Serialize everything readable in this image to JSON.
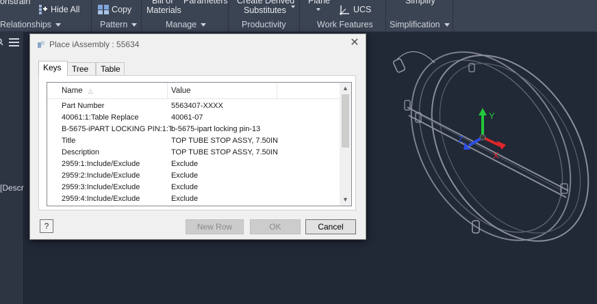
{
  "ribbon": {
    "top_items": [
      {
        "label": "onstrain",
        "icon": "constrain-icon"
      },
      {
        "label": "Hide All",
        "icon": "hide-all-icon"
      },
      {
        "label": "Copy",
        "icon": "copy-icon"
      },
      {
        "label": "Bill of",
        "icon": ""
      },
      {
        "label": "Materials",
        "icon": ""
      },
      {
        "label": "Parameters",
        "icon": ""
      },
      {
        "label": "Create Derived",
        "icon": ""
      },
      {
        "label": "Substitutes",
        "icon": ""
      },
      {
        "label": "Plane",
        "icon": "plane-icon"
      },
      {
        "label": "UCS",
        "icon": "ucs-icon"
      },
      {
        "label": "Simplify",
        "icon": ""
      }
    ],
    "panels": [
      {
        "label": "Relationships"
      },
      {
        "label": "Pattern"
      },
      {
        "label": "Manage"
      },
      {
        "label": "Productivity"
      },
      {
        "label": "Work Features"
      },
      {
        "label": "Simplification"
      }
    ]
  },
  "left": {
    "partial_text": "[Descri"
  },
  "dialog": {
    "title": "Place iAssembly : 55634",
    "tabs": [
      "Keys",
      "Tree",
      "Table"
    ],
    "columns": [
      "Name",
      "Value"
    ],
    "rows": [
      {
        "name": "Part Number",
        "value": "5563407-XXXX"
      },
      {
        "name": "40061:1:Table Replace",
        "value": "40061-07"
      },
      {
        "name": "B-5675-iPART LOCKING PIN:1:Ta",
        "value": "b-5675-ipart locking pin-13"
      },
      {
        "name": "Title",
        "value": "TOP TUBE STOP ASSY, 7.50IN"
      },
      {
        "name": "Description",
        "value": "TOP TUBE STOP ASSY, 7.50IN"
      },
      {
        "name": "2959:1:Include/Exclude",
        "value": "Exclude"
      },
      {
        "name": "2959:2:Include/Exclude",
        "value": "Exclude"
      },
      {
        "name": "2959:3:Include/Exclude",
        "value": "Exclude"
      },
      {
        "name": "2959:4:Include/Exclude",
        "value": "Exclude"
      }
    ],
    "buttons": {
      "help": "?",
      "new_row": "New Row",
      "ok": "OK",
      "cancel": "Cancel"
    }
  },
  "viewcube": {
    "x_label": "X",
    "y_label": "Y",
    "z_label": "Z"
  },
  "colors": {
    "ribbon_bg": "#3b4453",
    "viewport_bg": "#212836",
    "axis_x": "#e0262b",
    "axis_y": "#22c93a",
    "axis_z": "#2a4ee8"
  }
}
